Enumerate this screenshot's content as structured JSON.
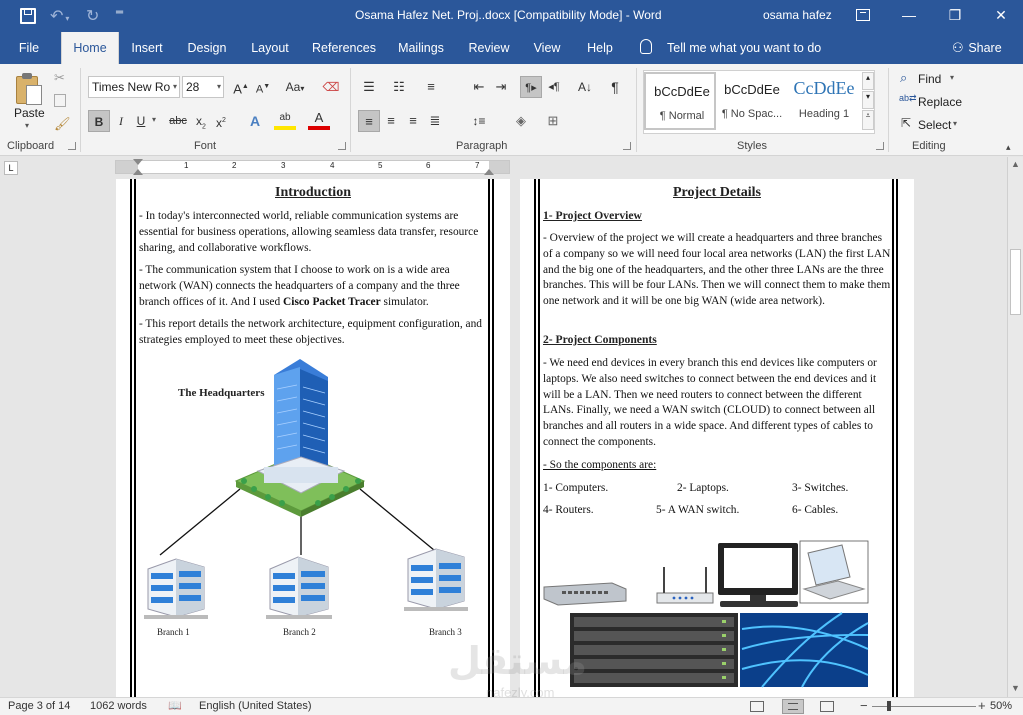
{
  "titlebar": {
    "doc_title": "Osama Hafez Net. Proj..docx [Compatibility Mode]  -  Word",
    "user": "osama hafez",
    "save_icon": "save-icon",
    "undo_icon": "undo-icon",
    "redo_icon": "redo-icon"
  },
  "tabs": {
    "file": "File",
    "home": "Home",
    "insert": "Insert",
    "design": "Design",
    "layout": "Layout",
    "references": "References",
    "mailings": "Mailings",
    "review": "Review",
    "view": "View",
    "help": "Help",
    "tellme": "Tell me what you want to do",
    "share": "Share"
  },
  "ribbon": {
    "clipboard": {
      "paste": "Paste",
      "label": "Clipboard"
    },
    "font": {
      "name": "Times New Ro",
      "size": "28",
      "label": "Font",
      "grow": "Aa",
      "bold": "B",
      "italic": "I",
      "underline": "U",
      "strike": "abc",
      "sub": "x",
      "sup": "x",
      "sub_mark": "2",
      "sup_mark": "2"
    },
    "paragraph": {
      "label": "Paragraph",
      "pilcrow": "¶"
    },
    "styles": {
      "label": "Styles",
      "items": [
        {
          "sample": "bCcDdEe",
          "name": "¶ Normal"
        },
        {
          "sample": "bCcDdEe",
          "name": "¶ No Spac..."
        },
        {
          "sample": "CcDdEe",
          "name": "Heading 1"
        }
      ]
    },
    "editing": {
      "label": "Editing",
      "find": "Find",
      "replace": "Replace",
      "select": "Select"
    }
  },
  "ruler": {
    "ticks": [
      "1",
      "2",
      "3",
      "4",
      "5",
      "6",
      "7"
    ]
  },
  "left_page": {
    "title": "Introduction",
    "p1": "- In today's interconnected world, reliable communication systems are essential for business operations, allowing seamless data transfer, resource sharing, and collaborative workflows.",
    "p2_a": "- The communication system that I choose to work on is a wide area network (WAN) connects the headquarters of a company and the three branch offices of it. And I used ",
    "p2_b": "Cisco Packet Tracer",
    "p2_c": " simulator.",
    "p3": "- This report details the network architecture, equipment configuration, and strategies employed to meet these objectives.",
    "hq_label": "The Headquarters",
    "branch1": "Branch 1",
    "branch2": "Branch 2",
    "branch3": "Branch 3"
  },
  "right_page": {
    "title": "Project Details",
    "s1": "1- Project Overview",
    "p1": "- Overview of the project we will create a headquarters and three branches of a company so we will need four local area networks (LAN) the first LAN and the big one of the headquarters, and the other three LANs are the three branches. This will be four LANs. Then we will connect them to make them one network and it will be one big WAN (wide area network).",
    "s2": "2- Project Components",
    "p2": "- We need end devices in every branch this end devices like computers or laptops. We also need switches to connect between the end devices and it will be a LAN. Then we need routers to connect between the different LANs. Finally, we need a WAN switch (CLOUD) to connect between all branches and all routers in a wide space. And different types of cables to connect the components.",
    "p3": "- So the components are:",
    "comps": [
      "1- Computers.",
      "2- Laptops.",
      "3- Switches.",
      "4- Routers.",
      "5- A WAN switch.",
      "6- Cables."
    ]
  },
  "watermark": {
    "arabic": "مستقل",
    "latin": "nafezly.com"
  },
  "status": {
    "page": "Page 3 of 14",
    "words": "1062 words",
    "lang": "English (United States)",
    "zoom": "50%"
  },
  "colors": {
    "word_blue": "#2b579a",
    "ribbon_bg": "#f3f3f3"
  }
}
